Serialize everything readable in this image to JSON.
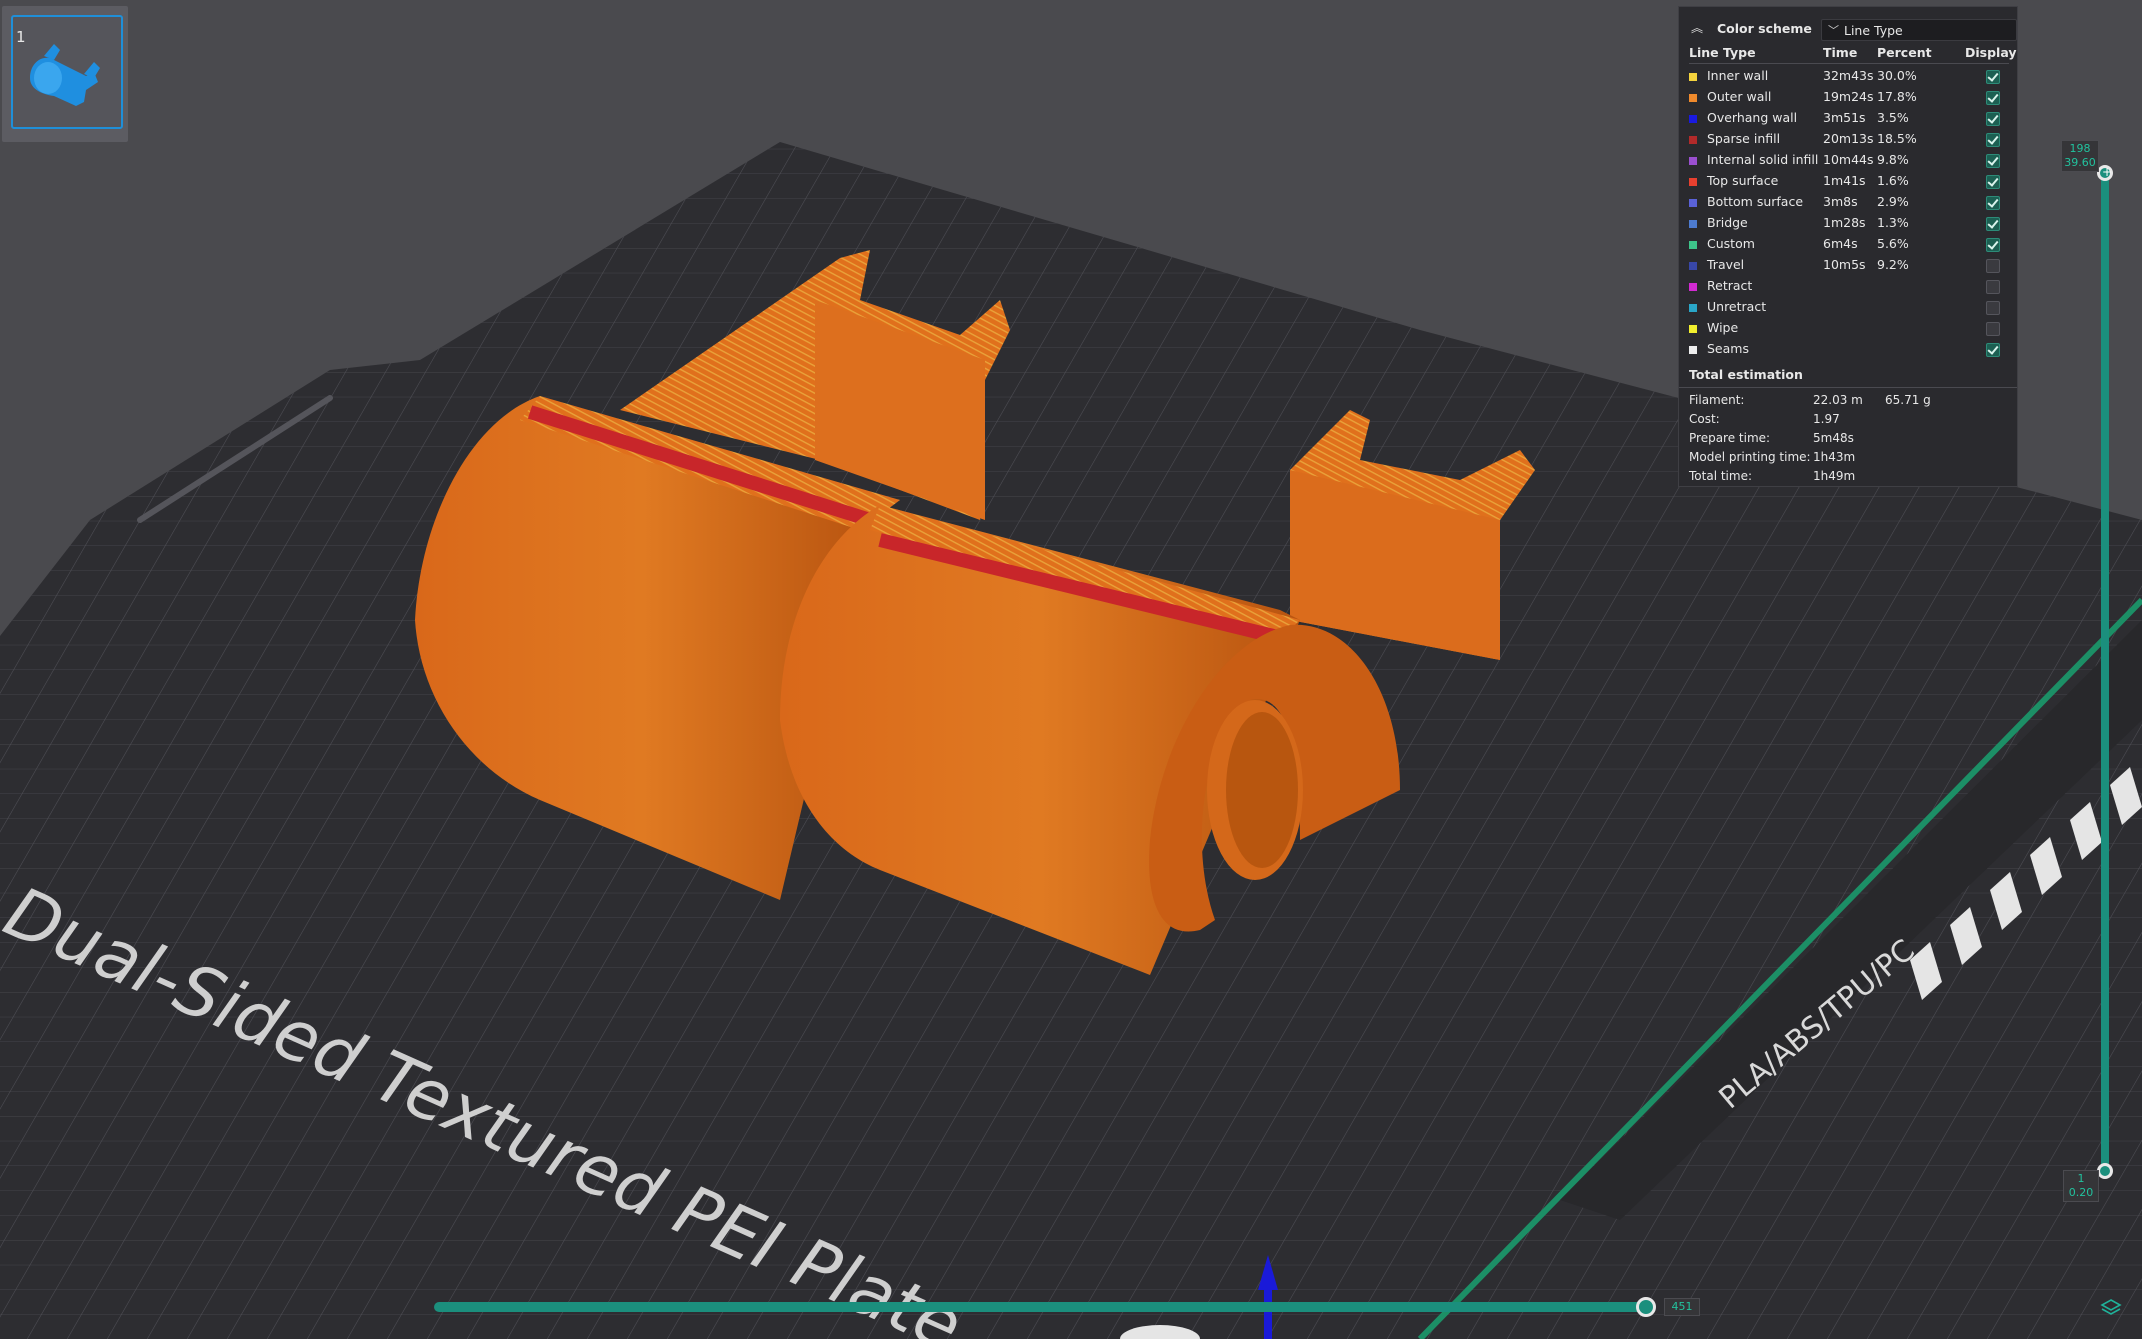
{
  "plate": {
    "number": "1"
  },
  "bed": {
    "label": "Dual-Sided Textured PEI Plate",
    "material_label": "PLA/ABS/TPU/PC"
  },
  "legend": {
    "color_scheme_label": "Color scheme",
    "color_scheme_value": "Line Type",
    "columns": {
      "type": "Line Type",
      "time": "Time",
      "percent": "Percent",
      "display": "Display"
    },
    "rows": [
      {
        "name": "Inner wall",
        "time": "32m43s",
        "percent": "30.0%",
        "color": "#f5d33d",
        "display": true
      },
      {
        "name": "Outer wall",
        "time": "19m24s",
        "percent": "17.8%",
        "color": "#f08a2c",
        "display": true
      },
      {
        "name": "Overhang wall",
        "time": "3m51s",
        "percent": "3.5%",
        "color": "#1a1ae0",
        "display": true
      },
      {
        "name": "Sparse infill",
        "time": "20m13s",
        "percent": "18.5%",
        "color": "#b22a2a",
        "display": true
      },
      {
        "name": "Internal solid infill",
        "time": "10m44s",
        "percent": "9.8%",
        "color": "#9b4fd0",
        "display": true
      },
      {
        "name": "Top surface",
        "time": "1m41s",
        "percent": "1.6%",
        "color": "#e8402f",
        "display": true
      },
      {
        "name": "Bottom surface",
        "time": "3m8s",
        "percent": "2.9%",
        "color": "#5a62d8",
        "display": true
      },
      {
        "name": "Bridge",
        "time": "1m28s",
        "percent": "1.3%",
        "color": "#4d7bd0",
        "display": true
      },
      {
        "name": "Custom",
        "time": "6m4s",
        "percent": "5.6%",
        "color": "#3dc48a",
        "display": true
      },
      {
        "name": "Travel",
        "time": "10m5s",
        "percent": "9.2%",
        "color": "#3847a8",
        "display": false
      },
      {
        "name": "Retract",
        "time": "",
        "percent": "",
        "color": "#d22ad2",
        "display": false
      },
      {
        "name": "Unretract",
        "time": "",
        "percent": "",
        "color": "#2aa6c8",
        "display": false
      },
      {
        "name": "Wipe",
        "time": "",
        "percent": "",
        "color": "#f2ef2e",
        "display": false
      },
      {
        "name": "Seams",
        "time": "",
        "percent": "",
        "color": "#eeeeee",
        "display": true
      }
    ],
    "estimation": {
      "title": "Total estimation",
      "filament_label": "Filament:",
      "filament_length": "22.03 m",
      "filament_weight": "65.71 g",
      "cost_label": "Cost:",
      "cost": "1.97",
      "prepare_label": "Prepare time:",
      "prepare": "5m48s",
      "model_label": "Model printing time:",
      "model": "1h43m",
      "total_label": "Total time:",
      "total": "1h49m"
    }
  },
  "layer_slider": {
    "top_layer": "198",
    "top_height": "39.60",
    "bottom_layer": "1",
    "bottom_height": "0.20"
  },
  "move_slider": {
    "value": "451"
  }
}
